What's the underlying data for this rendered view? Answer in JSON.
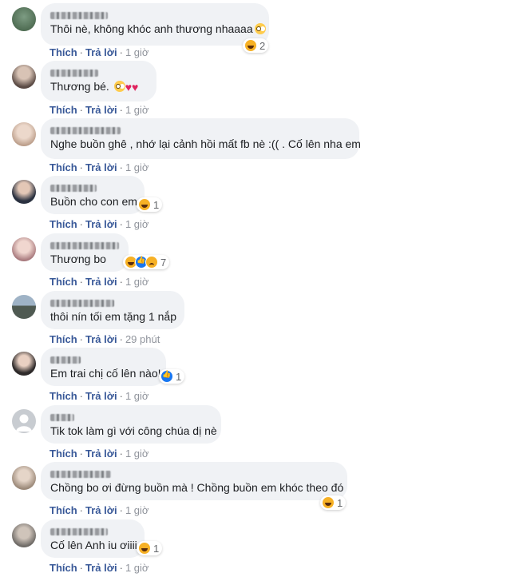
{
  "actions": {
    "like": "Thích",
    "reply": "Trả lời",
    "separator": "·"
  },
  "comments": [
    {
      "text": "Thôi nè, không khóc anh thương nhaaaa",
      "time": "1 giờ",
      "reaction_count": "2",
      "reactions": [
        "haha"
      ],
      "avatar_color": "#3d5a40"
    },
    {
      "text": "Thương bé.",
      "time": "1 giờ",
      "reaction_count": "",
      "reactions": [],
      "avatar_color": "#5a4a44"
    },
    {
      "text": "Nghe buồn ghê , nhớ lại cảnh hồi mất fb nè :(( . Cố lên nha em",
      "time": "1 giờ",
      "reaction_count": "",
      "reactions": [],
      "avatar_color": "#b89a86"
    },
    {
      "text": "Buồn cho con em",
      "time": "1 giờ",
      "reaction_count": "1",
      "reactions": [
        "haha"
      ],
      "avatar_color": "#2a3140"
    },
    {
      "text": "Thương bo",
      "time": "1 giờ",
      "reaction_count": "7",
      "reactions": [
        "haha",
        "like",
        "sad"
      ],
      "avatar_color": "#a7787c"
    },
    {
      "text": "thôi nín tối em tặng 1 nắp",
      "time": "29 phút",
      "reaction_count": "",
      "reactions": [],
      "avatar_color": "#4f5a52"
    },
    {
      "text": "Em trai chị cố lên nào!",
      "time": "1 giờ",
      "reaction_count": "1",
      "reactions": [
        "like"
      ],
      "avatar_color": "#2e2a2a"
    },
    {
      "text": "Tik tok làm gì với công chúa dị nè",
      "time": "1 giờ",
      "reaction_count": "",
      "reactions": [],
      "avatar_color": "#c8ccd1"
    },
    {
      "text": "Chồng bo ơi đừng buồn mà ! Chồng buồn em khóc theo đó",
      "time": "1 giờ",
      "reaction_count": "1",
      "reactions": [
        "haha"
      ],
      "avatar_color": "#9c8a7a"
    },
    {
      "text": "Cố lên Anh iu ơiiii",
      "time": "1 giờ",
      "reaction_count": "1",
      "reactions": [
        "haha"
      ],
      "avatar_color": "#6e6a66"
    }
  ]
}
